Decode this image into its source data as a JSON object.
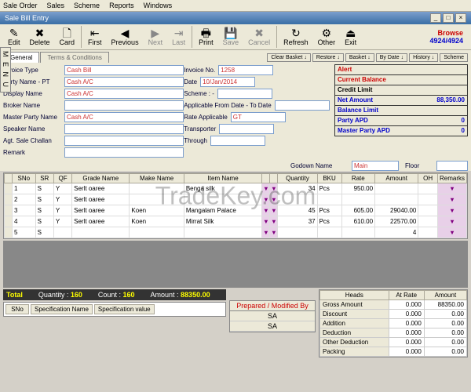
{
  "menubar": [
    "Sale Order",
    "Sales",
    "Scheme",
    "Reports",
    "Windows"
  ],
  "title": "Sale Bill Entry",
  "toolbar": [
    {
      "ico": "✎",
      "lbl": "Edit",
      "dis": false
    },
    {
      "ico": "✖",
      "lbl": "Delete",
      "dis": false
    },
    {
      "ico": "🗋",
      "lbl": "Card",
      "dis": false
    },
    {
      "ico": "⇤",
      "lbl": "First",
      "dis": false
    },
    {
      "ico": "◀",
      "lbl": "Previous",
      "dis": false
    },
    {
      "ico": "▶",
      "lbl": "Next",
      "dis": true
    },
    {
      "ico": "⇥",
      "lbl": "Last",
      "dis": true
    },
    {
      "ico": "🖶",
      "lbl": "Print",
      "dis": false
    },
    {
      "ico": "💾",
      "lbl": "Save",
      "dis": true
    },
    {
      "ico": "✖",
      "lbl": "Cancel",
      "dis": true
    },
    {
      "ico": "↻",
      "lbl": "Refresh",
      "dis": false
    },
    {
      "ico": "⚙",
      "lbl": "Other",
      "dis": false
    },
    {
      "ico": "⏏",
      "lbl": "Exit",
      "dis": false
    }
  ],
  "browse": {
    "label": "Browse",
    "count": "4924/4924"
  },
  "tabs": [
    "General",
    "Terms & Conditions"
  ],
  "minibtns": [
    "Clear Basket ↓",
    "Restore ↓",
    "Basket ↓",
    "By Date ↓",
    "History ↓",
    "Scheme"
  ],
  "form_left": [
    {
      "lbl": "Invoice Type",
      "val": "Cash Bill"
    },
    {
      "lbl": "Party Name - PT",
      "val": "Cash A/C"
    },
    {
      "lbl": "Display Name",
      "val": "Cash A/C"
    },
    {
      "lbl": "Broker Name",
      "val": ""
    },
    {
      "lbl": "Master Party Name",
      "val": "Cash A/C"
    },
    {
      "lbl": "Speaker Name",
      "val": ""
    },
    {
      "lbl": "Agt. Sale Challan",
      "val": ""
    },
    {
      "lbl": "Remark",
      "val": ""
    }
  ],
  "form_mid": [
    {
      "lbl": "Invoice No.",
      "val": "1258"
    },
    {
      "lbl": "Date",
      "val": "10/Jan/2014"
    },
    {
      "lbl": "Scheme : -",
      "val": ""
    },
    {
      "lbl": "Applicable From Date - To Date",
      "val": ""
    },
    {
      "lbl": "Rate Applicable",
      "val": "GT"
    },
    {
      "lbl": "Transporter",
      "val": ""
    },
    {
      "lbl": "Through",
      "val": ""
    }
  ],
  "alerts": [
    {
      "lbl": "Alert",
      "val": "",
      "cls": "red"
    },
    {
      "lbl": "Current Balance",
      "val": "",
      "cls": "red"
    },
    {
      "lbl": "Credit Limit",
      "val": "",
      "cls": "black"
    },
    {
      "lbl": "Net Amount",
      "val": "88,350.00",
      "cls": "blue"
    },
    {
      "lbl": "Balance Limit",
      "val": "",
      "cls": "blue"
    },
    {
      "lbl": "Party APD",
      "val": "0",
      "cls": "blue"
    },
    {
      "lbl": "Master Party APD",
      "val": "0",
      "cls": "blue"
    }
  ],
  "godown": {
    "lbl": "Godown Name",
    "val": "Main",
    "floor": "Floor"
  },
  "grid_cols": [
    "",
    "SNo",
    "SR",
    "QF",
    "Grade Name",
    "Make Name",
    "Item Name",
    "",
    "",
    "Quantity",
    "BKU",
    "Rate",
    "Amount",
    "OH",
    "Remarks"
  ],
  "grid_rows": [
    {
      "sno": "1",
      "sr": "S",
      "qf": "Y",
      "grade": "Serlt oaree",
      "make": "",
      "item": "Benga silk",
      "q": "34",
      "bku": "Pcs",
      "rate": "950.00",
      "amt": "",
      "oh": ""
    },
    {
      "sno": "2",
      "sr": "S",
      "qf": "Y",
      "grade": "Serlt oaree",
      "make": "",
      "item": "",
      "q": "",
      "bku": "",
      "rate": "",
      "amt": "",
      "oh": ""
    },
    {
      "sno": "3",
      "sr": "S",
      "qf": "Y",
      "grade": "Serlt oaree",
      "make": "Koen",
      "item": "Mangalam Palace",
      "q": "45",
      "bku": "Pcs",
      "rate": "605.00",
      "amt": "29040.00",
      "oh": ""
    },
    {
      "sno": "4",
      "sr": "S",
      "qf": "Y",
      "grade": "Serlt oaree",
      "make": "Koen",
      "item": "Mirrat Silk",
      "q": "37",
      "bku": "Pcs",
      "rate": "610.00",
      "amt": "22570.00",
      "oh": ""
    },
    {
      "sno": "5",
      "sr": "S",
      "qf": "",
      "grade": "",
      "make": "",
      "item": "",
      "q": "",
      "bku": "",
      "rate": "",
      "amt": "4",
      "oh": ""
    }
  ],
  "totals": {
    "qty_lbl": "Quantity :",
    "qty": "160",
    "cnt_lbl": "Count :",
    "cnt": "160",
    "amt_lbl": "Amount :",
    "amt": "88350.00",
    "tot": "Total"
  },
  "spec": {
    "c1": "SNo",
    "c2": "Specification Name",
    "c3": "Specification value"
  },
  "prepby": {
    "hdr": "Prepared / Modified By",
    "v1": "SA",
    "v2": "SA"
  },
  "heads_cols": [
    "Heads",
    "At Rate",
    "Amount"
  ],
  "heads": [
    {
      "h": "Gross Amount",
      "r": "0.000",
      "a": "88350.00"
    },
    {
      "h": "Discount",
      "r": "0.000",
      "a": "0.00"
    },
    {
      "h": "Addition",
      "r": "0.000",
      "a": "0.00"
    },
    {
      "h": "Deduction",
      "r": "0.000",
      "a": "0.00"
    },
    {
      "h": "Other Deduction",
      "r": "0.000",
      "a": "0.00"
    },
    {
      "h": "Packing",
      "r": "0.000",
      "a": "0.00"
    }
  ],
  "watermark": "TradeKey.com",
  "side": "M E N U"
}
